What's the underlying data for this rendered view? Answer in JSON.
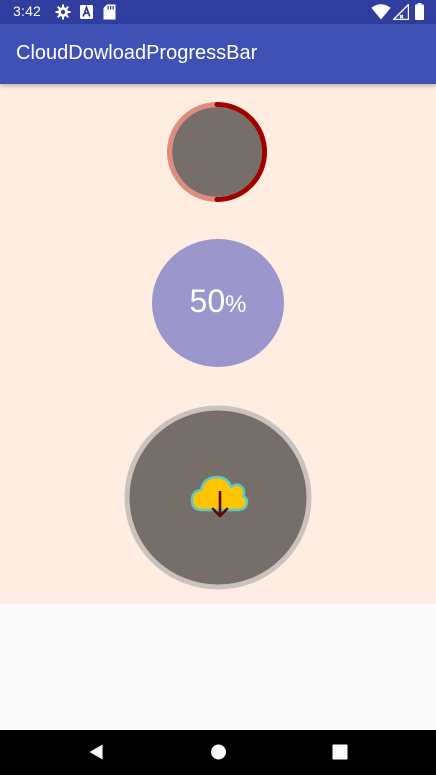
{
  "status_bar": {
    "time": "3:42",
    "icons": [
      "gear-icon",
      "a-badge-icon",
      "sd-card-icon",
      "wifi-icon",
      "signal-icon",
      "battery-icon"
    ],
    "background_color": "#303f9f"
  },
  "app_bar": {
    "title": "CloudDowloadProgressBar",
    "background_color": "#3f51b5"
  },
  "content": {
    "background_color": "#feede0",
    "ring_progress": {
      "progress": 0.5,
      "track_color": "#e08a80",
      "progress_color": "#a00000",
      "fill_color": "#766e68"
    },
    "percent_progress": {
      "value": "50",
      "unit": "%",
      "fill_color": "#9b96cc"
    },
    "cloud_download_button": {
      "icon": "cloud-download-icon",
      "fill_color": "#766e68",
      "border_color": "#c9c3c0",
      "cloud_color": "#ffc400",
      "arrow_color": "#5a0a0a"
    }
  },
  "nav_bar": {
    "buttons": [
      "back-icon",
      "home-icon",
      "recents-icon"
    ]
  }
}
